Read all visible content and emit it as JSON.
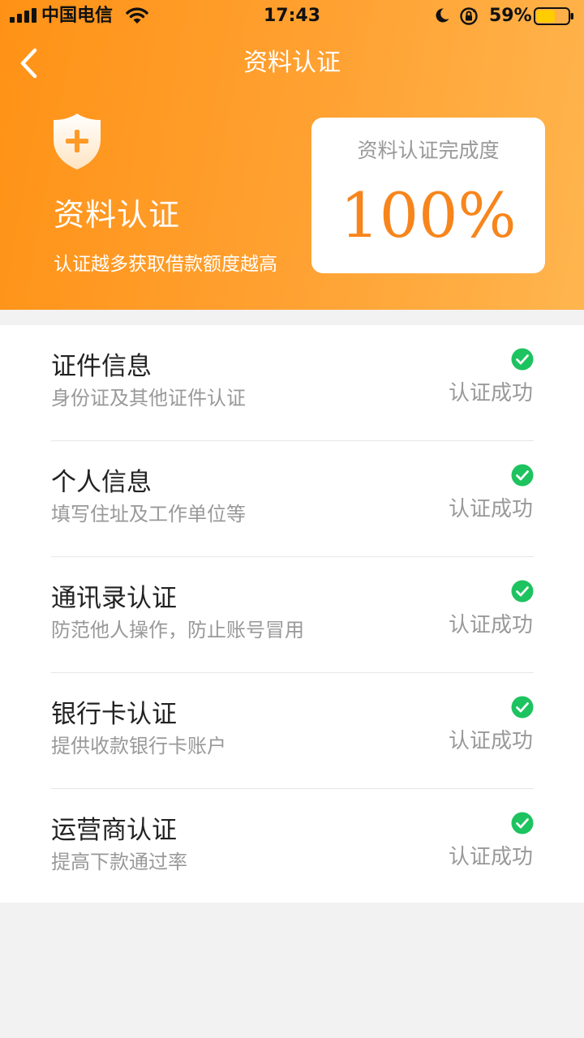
{
  "status_bar": {
    "carrier": "中国电信",
    "time": "17:43",
    "battery_percent": "59%",
    "battery_level": 0.59
  },
  "nav": {
    "title": "资料认证",
    "back_icon": "chevron-left-icon"
  },
  "hero": {
    "icon": "shield-plus-icon",
    "title": "资料认证",
    "subtitle": "认证越多获取借款额度越高",
    "completion_label": "资料认证完成度",
    "completion_value": "100%"
  },
  "items": [
    {
      "title": "证件信息",
      "subtitle": "身份证及其他证件认证",
      "status": "认证成功"
    },
    {
      "title": "个人信息",
      "subtitle": "填写住址及工作单位等",
      "status": "认证成功"
    },
    {
      "title": "通讯录认证",
      "subtitle": "防范他人操作，防止账号冒用",
      "status": "认证成功"
    },
    {
      "title": "银行卡认证",
      "subtitle": "提供收款银行卡账户",
      "status": "认证成功"
    },
    {
      "title": "运营商认证",
      "subtitle": "提高下款通过率",
      "status": "认证成功"
    }
  ],
  "colors": {
    "accent": "#ff9a26",
    "success": "#1dc35f",
    "percent": "#f7851c"
  }
}
